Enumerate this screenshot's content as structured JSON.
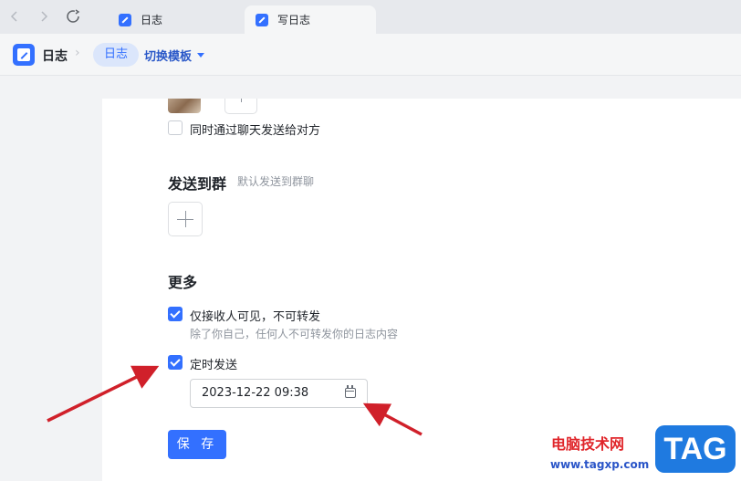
{
  "tabs": [
    {
      "label": "日志",
      "active": false
    },
    {
      "label": "写日志",
      "active": true
    }
  ],
  "breadcrumb": {
    "app_title": "日志",
    "current": "日志",
    "switch_template": "切换模板"
  },
  "sections": {
    "also_chat_label": "同时通过聊天发送给对方",
    "also_chat_checked": false,
    "send_to_group_heading": "发送到群",
    "send_to_group_hint": "默认发送到群聊",
    "more_heading": "更多",
    "recipients_only_label": "仅接收人可见，不可转发",
    "recipients_only_checked": true,
    "recipients_only_hint": "除了你自己，任何人不可转发你的日志内容",
    "scheduled_label": "定时发送",
    "scheduled_checked": true,
    "scheduled_datetime": "2023-12-22 09:38",
    "save_label": "保 存"
  },
  "watermark": {
    "cn_text": "电脑技术网",
    "url": "www.tagxp.com",
    "badge": "TAG"
  },
  "colors": {
    "accent": "#3370ff",
    "annotation_arrow": "#d0202a"
  },
  "icons": [
    "back-arrow-icon",
    "forward-arrow-icon",
    "refresh-icon",
    "doc-icon",
    "chevron-right-icon",
    "caret-down-icon",
    "plus-icon",
    "calendar-icon",
    "check-icon"
  ]
}
